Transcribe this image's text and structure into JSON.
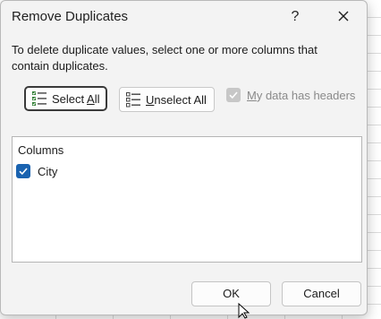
{
  "dialog": {
    "title": "Remove Duplicates",
    "help_label": "?",
    "description": "To delete duplicate values, select one or more columns that contain duplicates.",
    "select_all": {
      "label": "Select All",
      "u": "A",
      "pre": "Select ",
      "post": "ll",
      "icon": "select-all-icon"
    },
    "unselect_all": {
      "label": "Unselect All",
      "u": "U",
      "post": "nselect All",
      "icon": "unselect-all-icon"
    },
    "my_data_has_headers": {
      "label": "My data has headers",
      "u": "M",
      "post": "y data has headers",
      "checked": true,
      "enabled": false
    },
    "columns_header": "Columns",
    "columns": [
      {
        "label": "City",
        "checked": true
      }
    ],
    "ok_label": "OK",
    "cancel_label": "Cancel"
  },
  "colors": {
    "accent": "#1a63b0",
    "dialog_bg": "#f3f3f3"
  }
}
